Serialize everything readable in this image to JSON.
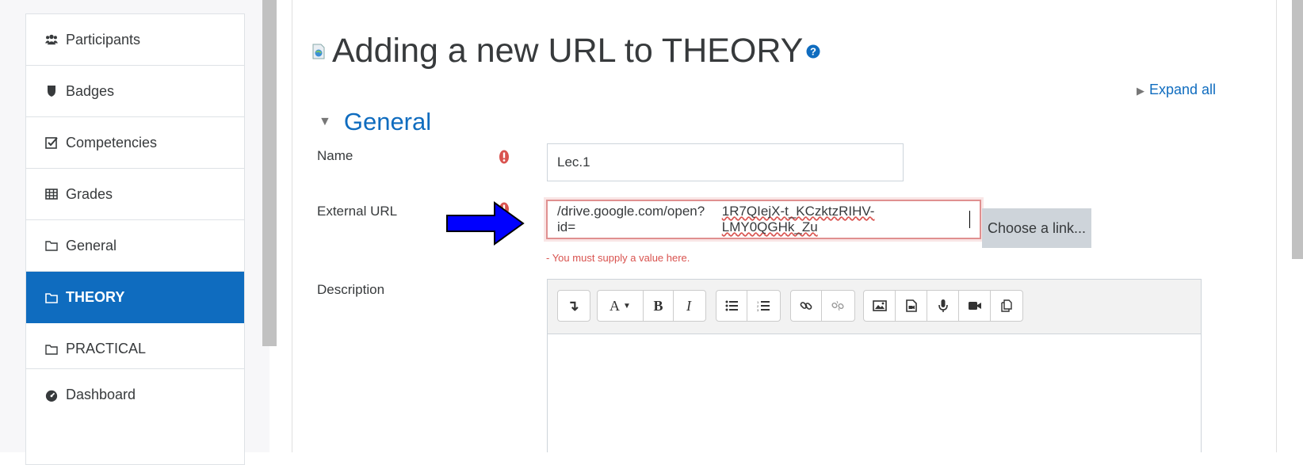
{
  "sidebar": {
    "items": [
      {
        "label": "Participants",
        "icon": "users-icon"
      },
      {
        "label": "Badges",
        "icon": "shield-icon"
      },
      {
        "label": "Competencies",
        "icon": "check-square-icon"
      },
      {
        "label": "Grades",
        "icon": "table-icon"
      },
      {
        "label": "General",
        "icon": "folder-icon"
      },
      {
        "label": "THEORY",
        "icon": "folder-icon",
        "active": true
      },
      {
        "label": "PRACTICAL",
        "icon": "folder-icon"
      }
    ],
    "dashboard": {
      "label": "Dashboard",
      "icon": "tachometer-icon"
    }
  },
  "main": {
    "title": "Adding a new URL to THEORY",
    "expand_all": "Expand all",
    "section": "General",
    "form": {
      "name_label": "Name",
      "name_value": "Lec.1",
      "url_label": "External URL",
      "url_value_plain": "/drive.google.com/open?id=",
      "url_value_flagged": "1R7QIejX-t_KCzktzRIHV-LMY0QGHk_Zu",
      "choose_link": "Choose a link...",
      "url_error": "- You must supply a value here.",
      "description_label": "Description"
    },
    "toolbar": {
      "bold": "B",
      "italic": "I",
      "font": "A"
    }
  },
  "colors": {
    "accent": "#0f6cbf",
    "error": "#d9534f",
    "arrow": "#0000ff"
  }
}
